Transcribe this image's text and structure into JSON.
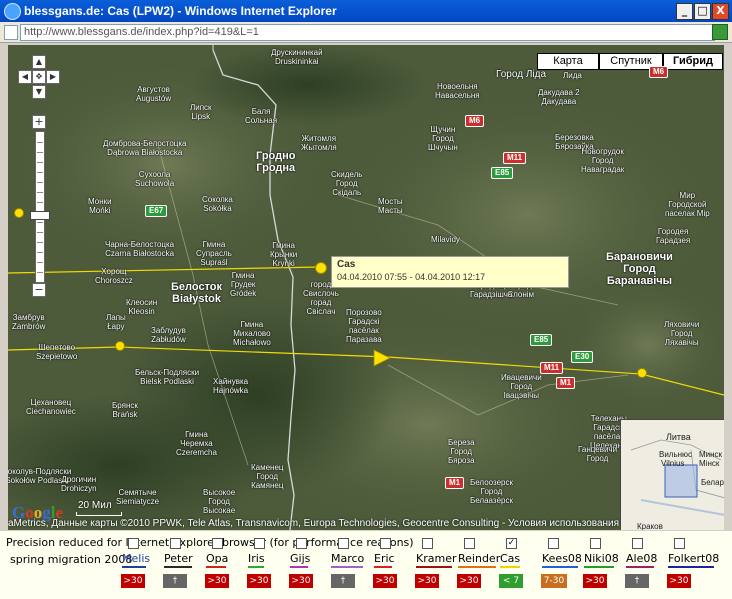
{
  "window": {
    "title": "blessgans.de: Cas (LPW2) - Windows Internet Explorer",
    "url": "http://www.blessgans.de/index.php?id=419&L=1",
    "minimize_glyph": "_",
    "maximize_glyph": "□",
    "close_glyph": "X"
  },
  "colors": {
    "titlebar": "#0a5fd8",
    "track": "#f2dc00",
    "road_shield_red": "#c9302c",
    "road_shield_green": "#2f9a3d",
    "infowindow": "#ffffc8",
    "badge_red": "#c00000",
    "badge_grey": "#666666",
    "badge_green": "#2e9e2e",
    "badge_orange": "#c86e1e"
  },
  "map": {
    "type_buttons": [
      "Карта",
      "Спутник",
      "Гибрид"
    ],
    "selected_type": "Гибрид",
    "pan_glyphs": {
      "up": "▲",
      "left": "◀",
      "right": "▶",
      "down": "▼",
      "center": "✥"
    },
    "zoom_in": "+",
    "zoom_out": "−",
    "infowindow": {
      "title": "Cas",
      "dates": "04.04.2010 07:55 - 04.04.2010 12:17"
    },
    "copyright": "aMetrics, Данные карты ©2010 PPWK, Tele Atlas, Transnavicom, Europa Technologies, Geocentre Consulting - Условия использования",
    "google_logo": "Google",
    "scale": "20 Мил",
    "labels": [
      {
        "text": "Друскининкай\nDruskininkai",
        "cls": ""
      },
      {
        "text": "Город Ліда",
        "cls": ""
      },
      {
        "text": "Лида",
        "cls": ""
      },
      {
        "text": "Новоельня\nНавасельня",
        "cls": ""
      },
      {
        "text": "Дакудава 2\nДакудава",
        "cls": ""
      },
      {
        "text": "Августов\nAugustów",
        "cls": ""
      },
      {
        "text": "Липск\nLipsk",
        "cls": ""
      },
      {
        "text": "Баля\nСольная",
        "cls": ""
      },
      {
        "text": "Житомля\nЖытомля",
        "cls": ""
      },
      {
        "text": "Щучин\nГород\nШчучын",
        "cls": ""
      },
      {
        "text": "Березовка\nБярозаўка",
        "cls": ""
      },
      {
        "text": "Новогрудок\nГород\nНаваградак",
        "cls": ""
      },
      {
        "text": "Домброва-Белостоцка\nDąbrowa Białostocka",
        "cls": ""
      },
      {
        "text": "Гродно\nГродна",
        "cls": "big"
      },
      {
        "text": "Скидель\nГород\nСкідаль",
        "cls": ""
      },
      {
        "text": "Сухоола\nSuchowola",
        "cls": ""
      },
      {
        "text": "Мир\nГородской\nпаселак Мір",
        "cls": ""
      },
      {
        "text": "Монки\nMońki",
        "cls": ""
      },
      {
        "text": "Соколка\nSokółka",
        "cls": ""
      },
      {
        "text": "Мосты\nМасты",
        "cls": ""
      },
      {
        "text": "Городея\nГарадзея",
        "cls": ""
      },
      {
        "text": "Чарна-Белостоцка\nCzarna Białostocka",
        "cls": ""
      },
      {
        "text": "Гмина\nСупрасль\nSupraśl",
        "cls": ""
      },
      {
        "text": "Гмина\nКрынки\nKrynki",
        "cls": ""
      },
      {
        "text": "Milavidy",
        "cls": ""
      },
      {
        "text": "Барановичи\nГород\nБаранавічы",
        "cls": "big"
      },
      {
        "text": "Хорощ\nChoroszcz",
        "cls": ""
      },
      {
        "text": "Белосток\nBiałystok",
        "cls": "big"
      },
      {
        "text": "Гмина\nГрудек\nGródek",
        "cls": ""
      },
      {
        "text": "город\nСвислочь\nгорад\nСвіслач",
        "cls": ""
      },
      {
        "text": "Слоним\nГород\nСлонім",
        "cls": ""
      },
      {
        "text": "Городищо\nГарадзішча",
        "cls": ""
      },
      {
        "text": "Замбрув\nZambrów",
        "cls": ""
      },
      {
        "text": "Клеосин\nKleosin",
        "cls": ""
      },
      {
        "text": "Лапы\nŁapy",
        "cls": ""
      },
      {
        "text": "Заблудув\nZabłudów",
        "cls": ""
      },
      {
        "text": "Гмина\nМихалово\nMichałowo",
        "cls": ""
      },
      {
        "text": "Порозово\nГарадскі\nпасёлак\nПаразава",
        "cls": ""
      },
      {
        "text": "Ляховичи\nГород\nЛяхавічы",
        "cls": ""
      },
      {
        "text": "Шепетово\nSzepietowo",
        "cls": ""
      },
      {
        "text": "Бельск-Подляски\nBielsk Podlaski",
        "cls": ""
      },
      {
        "text": "Хайнувка\nHajnówka",
        "cls": ""
      },
      {
        "text": "Ивацевичи\nГород\nІвацэвічы",
        "cls": ""
      },
      {
        "text": "Цехановец\nCiechanowiec",
        "cls": ""
      },
      {
        "text": "Брянск\nBrańsk",
        "cls": ""
      },
      {
        "text": "Телеханы\nГарадскі\nпасёлак\nЦелеханы",
        "cls": ""
      },
      {
        "text": "Гмина\nЧеремха\nCzeremcha",
        "cls": ""
      },
      {
        "text": "Каменец\nГород\nКамянец",
        "cls": ""
      },
      {
        "text": "Береза\nГород\nБяроза",
        "cls": ""
      },
      {
        "text": "Ганцевичи\nГород",
        "cls": ""
      },
      {
        "text": "Соколув-Подляски\nSokołów Podlaski",
        "cls": ""
      },
      {
        "text": "Дрогичин\nDrohiczyn",
        "cls": ""
      },
      {
        "text": "Семятыче\nSiemiatycze",
        "cls": ""
      },
      {
        "text": "Высокое\nГород\nВысокае",
        "cls": ""
      },
      {
        "text": "Белоозерск\nГород\nБелаазёрск",
        "cls": ""
      }
    ],
    "shields": [
      {
        "text": "M6",
        "color": "red"
      },
      {
        "text": "M6",
        "color": "red"
      },
      {
        "text": "M11",
        "color": "red"
      },
      {
        "text": "E85",
        "color": "green"
      },
      {
        "text": "E67",
        "color": "green"
      },
      {
        "text": "E85",
        "color": "green"
      },
      {
        "text": "E30",
        "color": "green"
      },
      {
        "text": "M11",
        "color": "red"
      },
      {
        "text": "M1",
        "color": "red"
      },
      {
        "text": "M1",
        "color": "red"
      }
    ],
    "overview": {
      "labels": [
        "Литва",
        "Вильнюс",
        "Vilnius",
        "Минск",
        "Мінск",
        "Белару",
        "Краков"
      ]
    }
  },
  "panel": {
    "notice": "Precision reduced for Internet Explorer browser (for performance reasons)",
    "season": "spring migration 2008",
    "birds": [
      {
        "name": "Melis",
        "checked": false,
        "color": "#1f3f9f",
        "badge": ">30",
        "badge_type": "red"
      },
      {
        "name": "Peter",
        "checked": false,
        "color": "#2a2a2a",
        "badge": "†",
        "badge_type": "grey"
      },
      {
        "name": "Opa",
        "checked": false,
        "color": "#d02020",
        "badge": ">30",
        "badge_type": "red"
      },
      {
        "name": "Iris",
        "checked": false,
        "color": "#2ea82e",
        "badge": ">30",
        "badge_type": "red"
      },
      {
        "name": "Gijs",
        "checked": false,
        "color": "#b030c0",
        "badge": ">30",
        "badge_type": "red"
      },
      {
        "name": "Marco",
        "checked": false,
        "color": "#a060d0",
        "badge": "†",
        "badge_type": "grey"
      },
      {
        "name": "Eric",
        "checked": false,
        "color": "#e02020",
        "badge": ">30",
        "badge_type": "red"
      },
      {
        "name": "Kramer",
        "checked": false,
        "color": "#a01010",
        "badge": ">30",
        "badge_type": "red"
      },
      {
        "name": "Reinder",
        "checked": false,
        "color": "#e07010",
        "badge": ">30",
        "badge_type": "red"
      },
      {
        "name": "Cas",
        "checked": true,
        "color": "#e8d800",
        "badge": "< 7",
        "badge_type": "green"
      },
      {
        "name": "Kees08",
        "checked": false,
        "color": "#2060e0",
        "badge": "7-30",
        "badge_type": "orange"
      },
      {
        "name": "Niki08",
        "checked": false,
        "color": "#20a020",
        "badge": ">30",
        "badge_type": "red"
      },
      {
        "name": "Ale08",
        "checked": false,
        "color": "#a02060",
        "badge": "†",
        "badge_type": "grey"
      },
      {
        "name": "Folkert08",
        "checked": false,
        "color": "#2020a0",
        "badge": ">30",
        "badge_type": "red"
      }
    ]
  }
}
